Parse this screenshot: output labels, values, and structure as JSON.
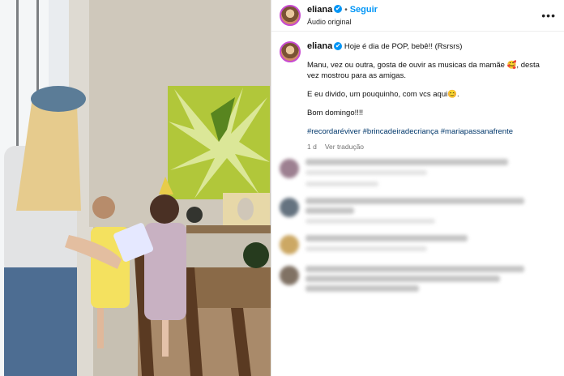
{
  "post": {
    "username": "eliana",
    "verified_icon": "✔",
    "separator": "•",
    "follow_label": "Seguir",
    "audio_label": "Áudio original",
    "more_icon": "•••"
  },
  "caption": {
    "username": "eliana",
    "line1": "Hoje é dia de POP, bebê!! (Rsrsrs)",
    "para2": "Manu, vez ou outra, gosta de ouvir as musicas da mamãe 🥰, desta vez mostrou para as amigas.",
    "para3": "E eu divido, um pouquinho, com vcs aqui😊.",
    "para4": "Bom domingo!!!!",
    "hashtags": "#recordaréviver #brincadeiradecriança #mariapassanafrente",
    "time": "1 d",
    "translate_label": "Ver tradução"
  },
  "colors": {
    "accent": "#0095f6",
    "hashtag": "#00376b",
    "story_ring": "#c74ad0"
  }
}
